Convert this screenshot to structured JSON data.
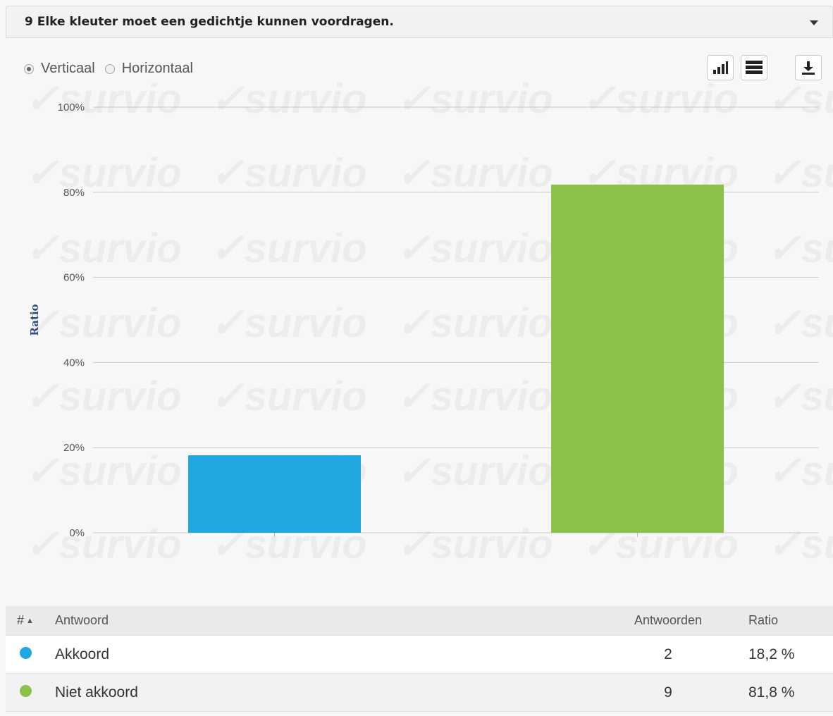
{
  "question": {
    "title": "9 Elke kleuter moet een gedichtje kunnen voordragen."
  },
  "orientation": {
    "options": [
      {
        "label": "Verticaal",
        "checked": true
      },
      {
        "label": "Horizontaal",
        "checked": false
      }
    ]
  },
  "toolbar": {
    "icons": [
      "bar-chart-icon",
      "table-icon",
      "download-icon"
    ]
  },
  "watermark_text": "survio",
  "chart_data": {
    "type": "bar",
    "categories": [
      "Akkoord",
      "Niet akkoord"
    ],
    "values": [
      18.2,
      81.8
    ],
    "colors": [
      "#1fa8df",
      "#8bc34a"
    ],
    "ylabel": "Ratio",
    "xlabel": "",
    "ylim": [
      0,
      100
    ],
    "yticks": [
      0,
      20,
      40,
      60,
      80,
      100
    ],
    "ytick_labels": [
      "0%",
      "20%",
      "40%",
      "60%",
      "80%",
      "100%"
    ],
    "grid": true
  },
  "table": {
    "headers": {
      "hash": "#",
      "answer": "Antwoord",
      "count": "Antwoorden",
      "ratio": "Ratio"
    },
    "rows": [
      {
        "color": "#1fa8df",
        "answer": "Akkoord",
        "count": "2",
        "ratio": "18,2 %"
      },
      {
        "color": "#8bc34a",
        "answer": "Niet akkoord",
        "count": "9",
        "ratio": "81,8 %"
      }
    ]
  }
}
